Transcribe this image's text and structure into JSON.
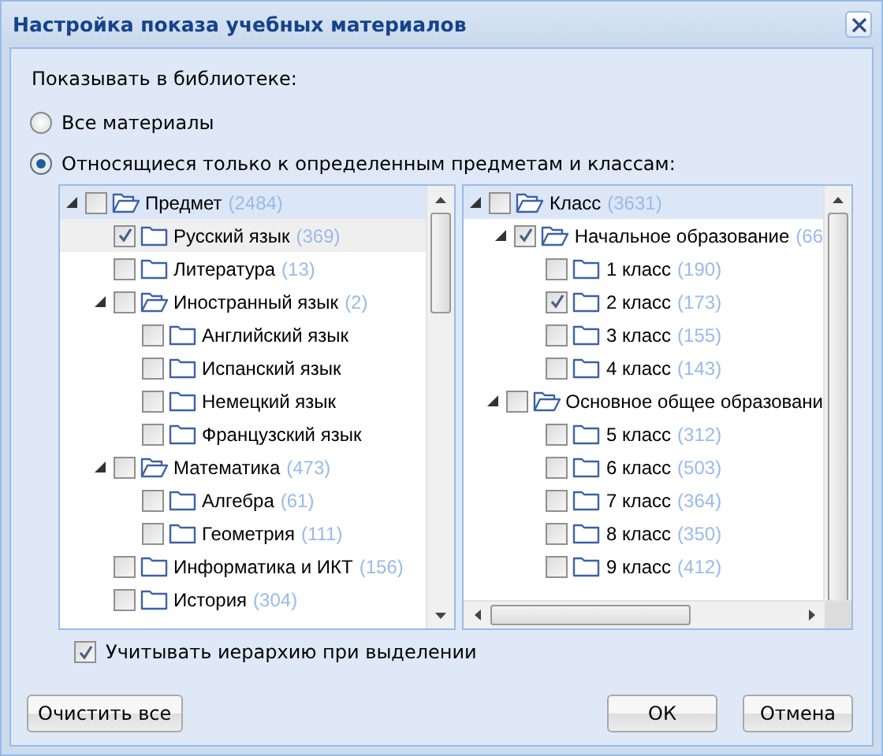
{
  "window": {
    "title": "Настройка показа учебных материалов"
  },
  "library_label": "Показывать в библиотеке:",
  "options": [
    {
      "label": "Все материалы",
      "selected": false
    },
    {
      "label": "Относящиеся только к определенным предметам и классам:",
      "selected": true
    }
  ],
  "trees": [
    {
      "horizontal_scrollbar": false,
      "items": [
        {
          "label": "Предмет",
          "count": "(2484)",
          "checked": false,
          "expanded": true,
          "selected": true,
          "hovered": false,
          "children": [
            {
              "label": "Русский язык",
              "count": "(369)",
              "checked": true,
              "expanded": false,
              "selected": false,
              "hovered": true
            },
            {
              "label": "Литература",
              "count": "(13)",
              "checked": false,
              "expanded": false,
              "selected": false,
              "hovered": false
            },
            {
              "label": "Иностранный язык",
              "count": "(2)",
              "checked": false,
              "expanded": true,
              "selected": false,
              "hovered": false,
              "children": [
                {
                  "label": "Английский язык",
                  "checked": false,
                  "expanded": false,
                  "selected": false,
                  "hovered": false
                },
                {
                  "label": "Испанский язык",
                  "checked": false,
                  "expanded": false,
                  "selected": false,
                  "hovered": false
                },
                {
                  "label": "Немецкий язык",
                  "checked": false,
                  "expanded": false,
                  "selected": false,
                  "hovered": false
                },
                {
                  "label": "Французский язык",
                  "checked": false,
                  "expanded": false,
                  "selected": false,
                  "hovered": false
                }
              ]
            },
            {
              "label": "Математика",
              "count": "(473)",
              "checked": false,
              "expanded": true,
              "selected": false,
              "hovered": false,
              "children": [
                {
                  "label": "Алгебра",
                  "count": "(61)",
                  "checked": false,
                  "expanded": false,
                  "selected": false,
                  "hovered": false
                },
                {
                  "label": "Геометрия",
                  "count": "(111)",
                  "checked": false,
                  "expanded": false,
                  "selected": false,
                  "hovered": false
                }
              ]
            },
            {
              "label": "Информатика и ИКТ",
              "count": "(156)",
              "checked": false,
              "expanded": false,
              "selected": false,
              "hovered": false
            },
            {
              "label": "История",
              "count": "(304)",
              "checked": false,
              "expanded": false,
              "selected": false,
              "hovered": false
            }
          ]
        }
      ]
    },
    {
      "horizontal_scrollbar": true,
      "items": [
        {
          "label": "Класс",
          "count": "(3631)",
          "checked": false,
          "expanded": true,
          "selected": true,
          "hovered": false,
          "children": [
            {
              "label": "Начальное образование",
              "count": "(66",
              "checked": true,
              "expanded": true,
              "selected": false,
              "hovered": false,
              "children": [
                {
                  "label": "1 класс",
                  "count": "(190)",
                  "checked": false,
                  "expanded": false,
                  "selected": false,
                  "hovered": false
                },
                {
                  "label": "2 класс",
                  "count": "(173)",
                  "checked": true,
                  "expanded": false,
                  "selected": false,
                  "hovered": false
                },
                {
                  "label": "3 класс",
                  "count": "(155)",
                  "checked": false,
                  "expanded": false,
                  "selected": false,
                  "hovered": false
                },
                {
                  "label": "4 класс",
                  "count": "(143)",
                  "checked": false,
                  "expanded": false,
                  "selected": false,
                  "hovered": false
                }
              ]
            },
            {
              "label": "Основное общее образовани",
              "checked": false,
              "expanded": true,
              "selected": false,
              "hovered": false,
              "children": [
                {
                  "label": "5 класс",
                  "count": "(312)",
                  "checked": false,
                  "expanded": false,
                  "selected": false,
                  "hovered": false
                },
                {
                  "label": "6 класс",
                  "count": "(503)",
                  "checked": false,
                  "expanded": false,
                  "selected": false,
                  "hovered": false
                },
                {
                  "label": "7 класс",
                  "count": "(364)",
                  "checked": false,
                  "expanded": false,
                  "selected": false,
                  "hovered": false
                },
                {
                  "label": "8 класс",
                  "count": "(350)",
                  "checked": false,
                  "expanded": false,
                  "selected": false,
                  "hovered": false
                },
                {
                  "label": "9 класс",
                  "count": "(412)",
                  "checked": false,
                  "expanded": false,
                  "selected": false,
                  "hovered": false
                }
              ]
            }
          ]
        }
      ]
    }
  ],
  "hierarchy_checkbox": {
    "label": "Учитывать иерархию при выделении",
    "checked": true
  },
  "footer": {
    "clear_button": "Очистить все",
    "buttons": [
      "ОК",
      "Отмена"
    ]
  }
}
